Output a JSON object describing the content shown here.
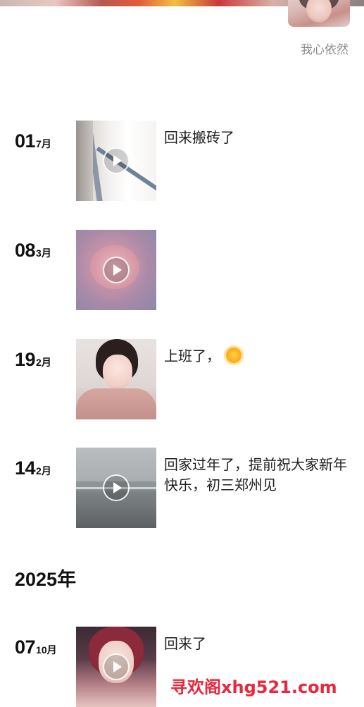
{
  "profile": {
    "nickname": "我心依然"
  },
  "posts": [
    {
      "day": "01",
      "month": "7月",
      "text": "回来搬砖了",
      "media": "video",
      "thumb_icon": "window-frame-thumbnail"
    },
    {
      "day": "08",
      "month": "3月",
      "text": "",
      "media": "video",
      "thumb_icon": "blurred-face-thumbnail"
    },
    {
      "day": "19",
      "month": "2月",
      "text": "上班了，",
      "emoji": "sun-icon",
      "media": "photo",
      "thumb_icon": "woman-portrait-thumbnail"
    },
    {
      "day": "14",
      "month": "2月",
      "text": "回家过年了，提前祝大家新年快乐，初三郑州见",
      "media": "video",
      "thumb_icon": "highway-landscape-thumbnail"
    }
  ],
  "year_header": "2025年",
  "posts_2025": [
    {
      "day": "07",
      "month": "10月",
      "text": "回来了",
      "media": "video",
      "thumb_icon": "woman-selfie-thumbnail"
    }
  ],
  "watermark": "寻欢阁xhg521.com",
  "colors": {
    "watermark": "#e8283c",
    "nickname": "#8a8a8a"
  }
}
